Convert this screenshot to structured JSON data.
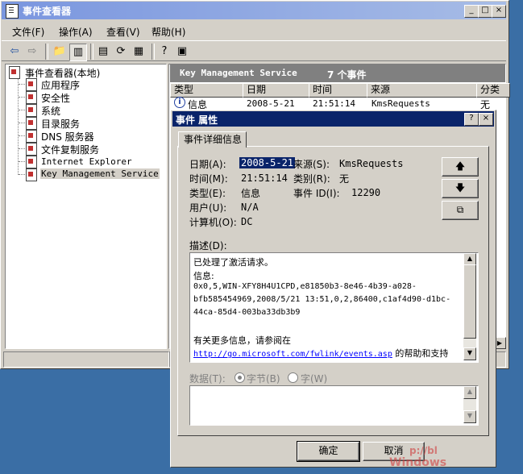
{
  "window": {
    "title": "事件查看器"
  },
  "menu": [
    "文件(F)",
    "操作(A)",
    "查看(V)",
    "帮助(H)"
  ],
  "tree": [
    {
      "label": "事件查看器(本地)"
    },
    {
      "label": "应用程序"
    },
    {
      "label": "安全性"
    },
    {
      "label": "系统"
    },
    {
      "label": "目录服务"
    },
    {
      "label": "DNS 服务器"
    },
    {
      "label": "文件复制服务"
    },
    {
      "label": "Internet Explorer"
    },
    {
      "label": "Key Management Service"
    }
  ],
  "right_header": {
    "title": "Key Management Service",
    "count": "7 个事件"
  },
  "columns": [
    "类型",
    "日期",
    "时间",
    "来源",
    "分类"
  ],
  "row": {
    "type": "信息",
    "date": "2008-5-21",
    "time": "21:51:14",
    "source": "KmsRequests",
    "category": "无"
  },
  "dialog": {
    "title": "事件 属性",
    "tab": "事件详细信息",
    "date_label": "日期(A):",
    "date": "2008-5-21",
    "source_label": "来源(S):",
    "source": "KmsRequests",
    "time_label": "时间(M):",
    "time": "21:51:14",
    "category_label": "类别(R):",
    "category": "无",
    "type_label": "类型(E):",
    "type": "信息",
    "eventid_label": "事件 ID(I):",
    "eventid": "12290",
    "user_label": "用户(U):",
    "user": "N/A",
    "computer_label": "计算机(O):",
    "computer": "DC",
    "desc_label": "描述(D):",
    "desc_lines": [
      "已处理了激活请求。",
      "信息:",
      "0x0,5,WIN-XFY8H4U1CPD,e81850b3-8e46-4b39-a028-",
      "bfb585454969,2008/5/21 13:51,0,2,86400,c1af4d90-d1bc-",
      "44ca-85d4-003ba33db3b9",
      "",
      "有关更多信息，请参阅在"
    ],
    "desc_link": "http://go.microsoft.com/fwlink/events.asp",
    "desc_link_suffix": "的帮助和支持",
    "data_label": "数据(T):",
    "radio_bytes": "字节(B)",
    "radio_words": "字(W)",
    "ok": "确定",
    "cancel": "取消"
  },
  "watermark": {
    "site": "p://bl",
    "brand": "Windows"
  }
}
